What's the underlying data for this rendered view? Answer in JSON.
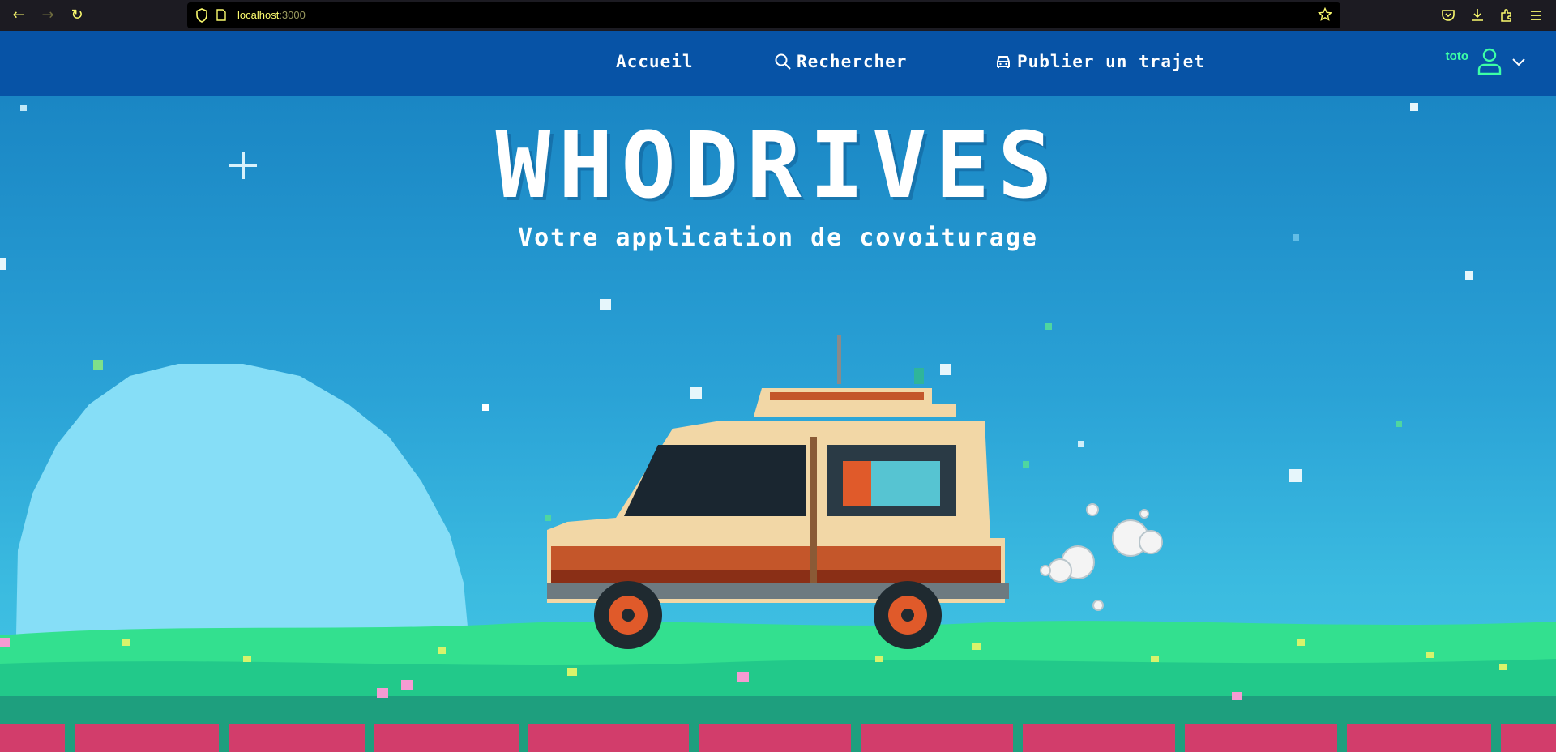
{
  "browser": {
    "url_host": "localhost",
    "url_port": ":3000"
  },
  "nav": {
    "home": "Accueil",
    "search": "Rechercher",
    "publish": "Publier un trajet"
  },
  "user": {
    "name": "toto"
  },
  "hero": {
    "title": "WHODRIVES",
    "subtitle": "Votre application de covoiturage"
  },
  "colors": {
    "header_bg": "#0753a6",
    "user_accent": "#3dffa6",
    "url_text": "#fbfb6e"
  }
}
